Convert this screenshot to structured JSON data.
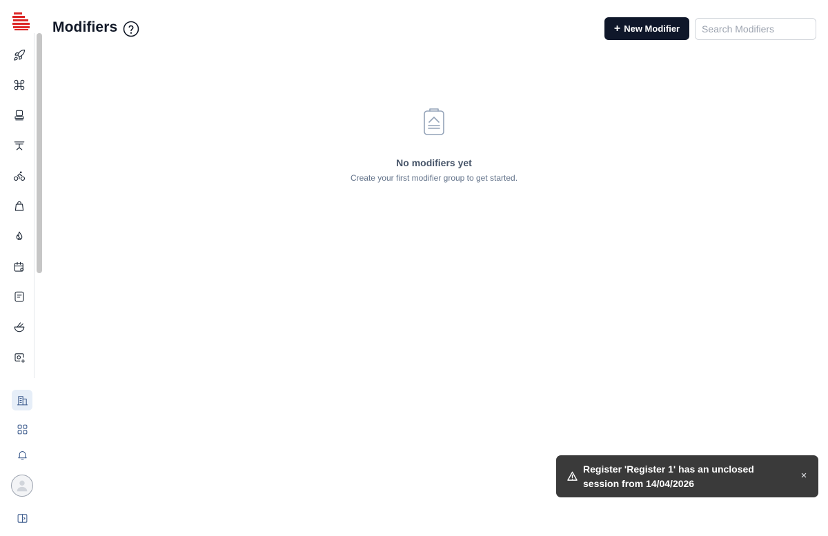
{
  "header": {
    "title": "Modifiers",
    "new_button_label": "New Modifier",
    "new_button_plus": "+",
    "search_placeholder": "Search Modifiers",
    "search_value": ""
  },
  "sidebar": {
    "nav_icons": [
      "rocket-icon",
      "command-icon",
      "stamp-icon",
      "table-icon",
      "bicycle-icon",
      "bag-icon",
      "flame-icon",
      "calendar-settings-icon",
      "receipt-icon",
      "bowl-icon",
      "camera-plus-icon"
    ],
    "bottom_icons": [
      "building-icon",
      "apps-grid-icon",
      "bell-icon",
      "user-avatar",
      "sidebar-toggle-icon"
    ]
  },
  "empty_state": {
    "title": "No modifiers yet",
    "subtitle": "Create your first modifier group to get started."
  },
  "toast": {
    "message": "Register 'Register 1' has an unclosed session from 14/04/2026",
    "close_glyph": "×"
  },
  "colors": {
    "primary_button": "#0f172a",
    "brand_red": "#dc2626",
    "toast_bg": "#3a3a3a",
    "active_item_bg": "#e6eef8"
  }
}
